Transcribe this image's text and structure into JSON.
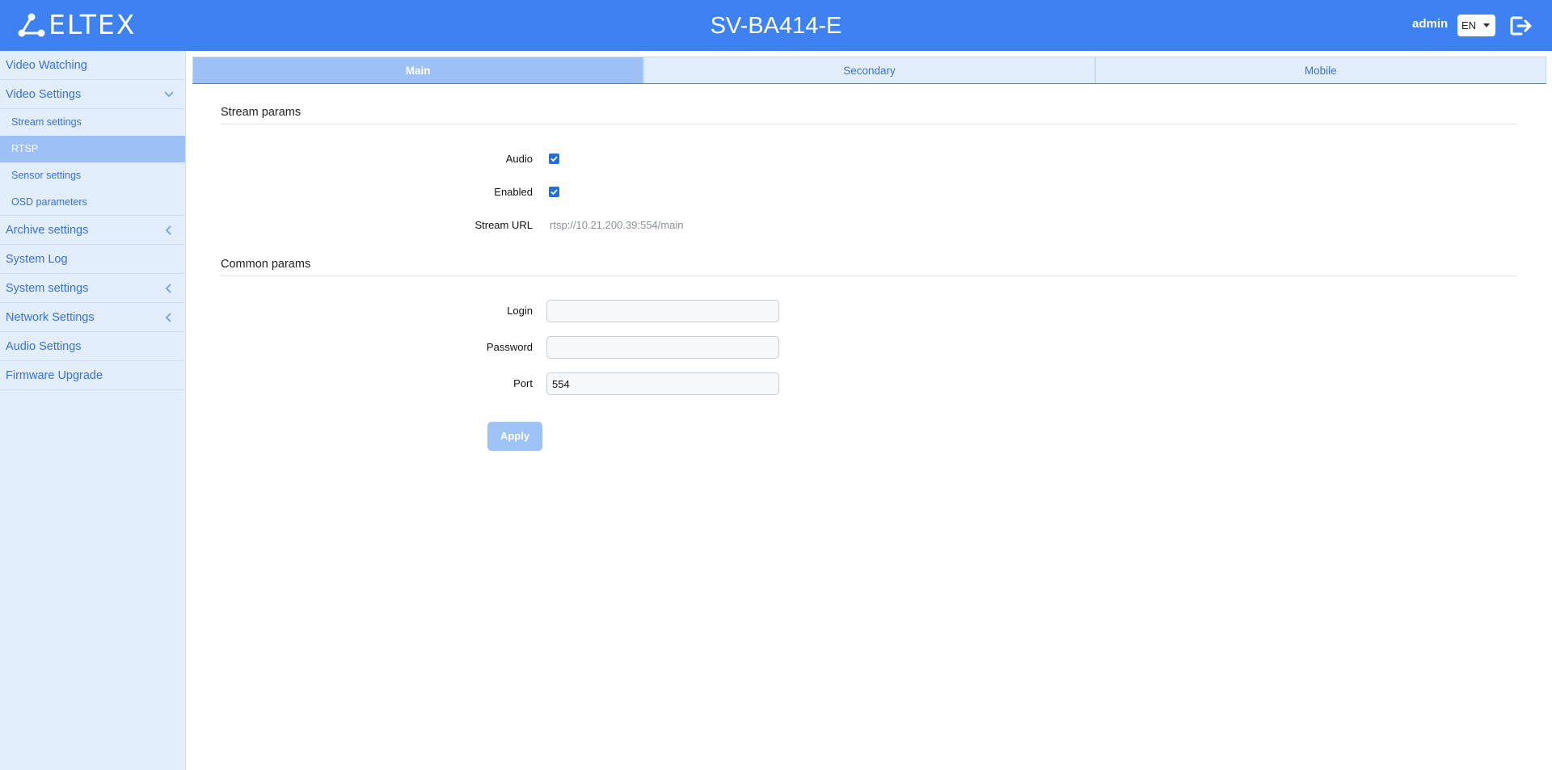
{
  "header": {
    "logo_text": "ELTEX",
    "device_title": "SV-BA414-E",
    "user": "admin",
    "language": "EN"
  },
  "sidebar": {
    "items": [
      {
        "label": "Video Watching"
      },
      {
        "label": "Video Settings",
        "expanded": true,
        "children": [
          {
            "label": "Stream settings"
          },
          {
            "label": "RTSP",
            "active": true
          },
          {
            "label": "Sensor settings"
          },
          {
            "label": "OSD parameters"
          }
        ]
      },
      {
        "label": "Archive settings",
        "expandable": true
      },
      {
        "label": "System Log"
      },
      {
        "label": "System settings",
        "expandable": true
      },
      {
        "label": "Network Settings",
        "expandable": true
      },
      {
        "label": "Audio Settings"
      },
      {
        "label": "Firmware Upgrade"
      }
    ]
  },
  "tabs": [
    {
      "label": "Main",
      "active": true
    },
    {
      "label": "Secondary"
    },
    {
      "label": "Mobile"
    }
  ],
  "stream_params": {
    "title": "Stream params",
    "audio_label": "Audio",
    "audio_checked": true,
    "enabled_label": "Enabled",
    "enabled_checked": true,
    "url_label": "Stream URL",
    "url_value": "rtsp://10.21.200.39:554/main"
  },
  "common_params": {
    "title": "Common params",
    "login_label": "Login",
    "login_value": "",
    "password_label": "Password",
    "password_value": "",
    "port_label": "Port",
    "port_value": "554"
  },
  "apply_label": "Apply",
  "colors": {
    "header_bg": "#3d82f0",
    "sidebar_bg": "#e3eefc",
    "active_item_bg": "#9dc0f5",
    "link_text": "#3a72d6",
    "apply_bg": "#9dc3f7"
  }
}
